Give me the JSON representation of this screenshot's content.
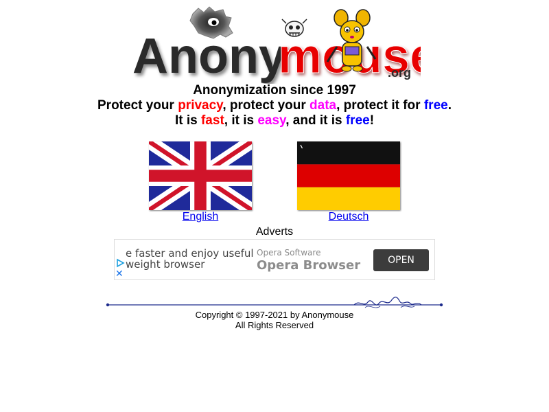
{
  "logo": {
    "main_text_dark": "Anony",
    "main_text_red": "mouse",
    "domain": ".org",
    "icon": "mouse-mascot-icon"
  },
  "tagline": {
    "line1": "Anonymization since 1997",
    "line2": {
      "part1": "Protect your ",
      "word1": "privacy",
      "part2": ", protect your ",
      "word2": "data",
      "part3": ", protect it for ",
      "word3": "free",
      "part4": "."
    },
    "line3": {
      "part1": "It is ",
      "word1": "fast",
      "part2": ", it is ",
      "word2": "easy",
      "part3": ", and it is ",
      "word3": "free",
      "part4": "!"
    }
  },
  "languages": {
    "english_label": "English",
    "deutsch_label": "Deutsch",
    "english_flag_icon": "uk-flag-icon",
    "deutsch_flag_icon": "german-flag-icon"
  },
  "adverts": {
    "label": "Adverts",
    "left_line1": "e faster and enjoy useful",
    "left_line2": "weight browser",
    "brand_small": "Opera Software",
    "brand_big": "Opera Browser",
    "cta": "OPEN",
    "adchoices_icon": "adchoices-icon",
    "close_icon": "close-icon",
    "close_glyph": "✕"
  },
  "footer": {
    "copyright": "Copyright © 1997-2021 by Anonymouse",
    "rights": "All Rights Reserved"
  },
  "colors": {
    "red": "#ff0000",
    "magenta": "#ff00ff",
    "blue": "#0000ff",
    "link": "#0000ee",
    "divider": "#1c2a8c"
  }
}
